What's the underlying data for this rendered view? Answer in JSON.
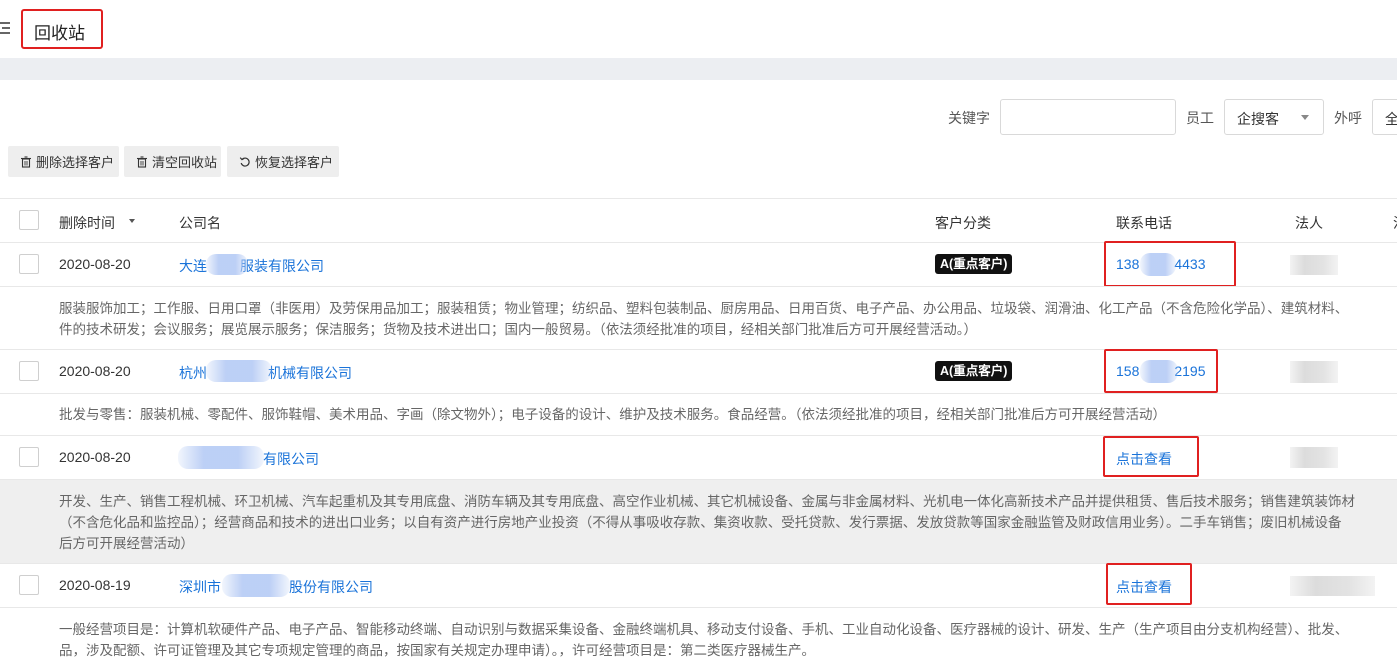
{
  "header": {
    "title": "回收站",
    "menu_icon": "menu-fold-icon"
  },
  "filters": {
    "keyword_label": "关键字",
    "keyword_value": "",
    "employee_label": "员工",
    "employee_value": "企搜客",
    "outbound_label": "外呼",
    "outbound_value": "全"
  },
  "toolbar": {
    "delete_label": "删除选择客户",
    "clear_label": "清空回收站",
    "restore_label": "恢复选择客户"
  },
  "table": {
    "columns": [
      "删除时间",
      "公司名",
      "客户分类",
      "联系电话",
      "法人",
      "注"
    ],
    "rows": [
      {
        "date": "2020-08-20",
        "company_a": "大连",
        "company_b": "服装有限公司",
        "category": "A(重点客户)",
        "phone_a": "138",
        "phone_b": "4433",
        "desc1": "服装服饰加工；工作服、日用口罩（非医用）及劳保用品加工；服装租赁；物业管理；纺织品、塑料包装制品、厨房用品、日用百货、电子产品、办公用品、垃圾袋、润滑油、化工产品（不含危险化学品）、建筑材料、",
        "desc2": "件的技术研发；会议服务；展览展示服务；保洁服务；货物及技术进出口；国内一般贸易。（依法须经批准的项目，经相关部门批准后方可开展经营活动。）"
      },
      {
        "date": "2020-08-20",
        "company_a": "杭州",
        "company_b": "机械有限公司",
        "category": "A(重点客户)",
        "phone_a": "158",
        "phone_b": "2195",
        "desc1": "批发与零售：服装机械、零配件、服饰鞋帽、美术用品、字画（除文物外）；电子设备的设计、维护及技术服务。食品经营。（依法须经批准的项目，经相关部门批准后方可开展经营活动）"
      },
      {
        "date": "2020-08-20",
        "company_b": "有限公司",
        "phone_link": "点击查看",
        "desc1": "开发、生产、销售工程机械、环卫机械、汽车起重机及其专用底盘、消防车辆及其专用底盘、高空作业机械、其它机械设备、金属与非金属材料、光机电一体化高新技术产品并提供租赁、售后技术服务；销售建筑装饰材",
        "desc2": "（不含危化品和监控品）；经营商品和技术的进出口业务；以自有资产进行房地产业投资（不得从事吸收存款、集资收款、受托贷款、发行票据、发放贷款等国家金融监管及财政信用业务）。二手车销售；废旧机械设备",
        "desc3": "后方可开展经营活动）"
      },
      {
        "date": "2020-08-19",
        "company_a": "深圳市",
        "company_b": "股份有限公司",
        "phone_link": "点击查看",
        "desc1": "一般经营项目是：计算机软硬件产品、电子产品、智能移动终端、自动识别与数据采集设备、金融终端机具、移动支付设备、手机、工业自动化设备、医疗器械的设计、研发、生产（生产项目由分支机构经营）、批发、",
        "desc2": "品，涉及配额、许可证管理及其它专项规定管理的商品，按国家有关规定办理申请）。，许可经营项目是：第二类医疗器械生产。"
      }
    ]
  },
  "colors": {
    "link": "#1a73d9",
    "highlight_box": "#e02020",
    "tag_bg": "#111111"
  }
}
